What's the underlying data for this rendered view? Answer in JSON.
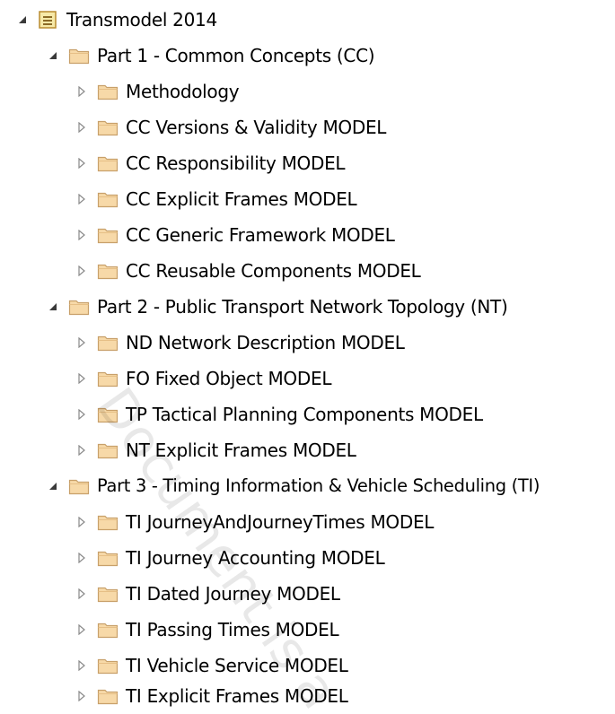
{
  "tree": {
    "root": {
      "label": "Transmodel 2014",
      "expanded": true,
      "icon": "package-icon"
    },
    "parts": [
      {
        "label": "Part 1 - Common Concepts (CC)",
        "expanded": true,
        "icon": "folder-icon",
        "children": [
          {
            "label": "Methodology",
            "expanded": false,
            "icon": "folder-icon"
          },
          {
            "label": "CC Versions & Validity MODEL",
            "expanded": false,
            "icon": "folder-icon"
          },
          {
            "label": "CC Responsibility MODEL",
            "expanded": false,
            "icon": "folder-icon"
          },
          {
            "label": "CC Explicit Frames MODEL",
            "expanded": false,
            "icon": "folder-icon"
          },
          {
            "label": "CC Generic Framework MODEL",
            "expanded": false,
            "icon": "folder-icon"
          },
          {
            "label": "CC Reusable Components MODEL",
            "expanded": false,
            "icon": "folder-icon"
          }
        ]
      },
      {
        "label": "Part 2 - Public Transport Network Topology (NT)",
        "expanded": true,
        "icon": "folder-icon",
        "children": [
          {
            "label": "ND Network Description MODEL",
            "expanded": false,
            "icon": "folder-icon"
          },
          {
            "label": "FO Fixed Object MODEL",
            "expanded": false,
            "icon": "folder-icon"
          },
          {
            "label": "TP Tactical Planning Components MODEL",
            "expanded": false,
            "icon": "folder-icon"
          },
          {
            "label": "NT Explicit Frames MODEL",
            "expanded": false,
            "icon": "folder-icon"
          }
        ]
      },
      {
        "label": "Part 3 - Timing Information & Vehicle Scheduling (TI)",
        "expanded": true,
        "icon": "folder-icon",
        "children": [
          {
            "label": "TI JourneyAndJourneyTimes MODEL",
            "expanded": false,
            "icon": "folder-icon"
          },
          {
            "label": "TI Journey Accounting MODEL",
            "expanded": false,
            "icon": "folder-icon"
          },
          {
            "label": "TI Dated Journey MODEL",
            "expanded": false,
            "icon": "folder-icon"
          },
          {
            "label": "TI Passing Times MODEL",
            "expanded": false,
            "icon": "folder-icon"
          },
          {
            "label": "TI Vehicle Service MODEL",
            "expanded": false,
            "icon": "folder-icon"
          },
          {
            "label": "TI Explicit Frames MODEL",
            "expanded": false,
            "icon": "folder-icon"
          }
        ]
      }
    ]
  },
  "watermark": {
    "text": "Document is a"
  },
  "colors": {
    "folder_fill": "#f7d9a8",
    "folder_stroke": "#c8a06a",
    "package_fill": "#f6e9a8",
    "package_stroke": "#b88b2e",
    "arrow_expanded": "#3a3a3a",
    "arrow_collapsed": "#8a8a8a"
  }
}
